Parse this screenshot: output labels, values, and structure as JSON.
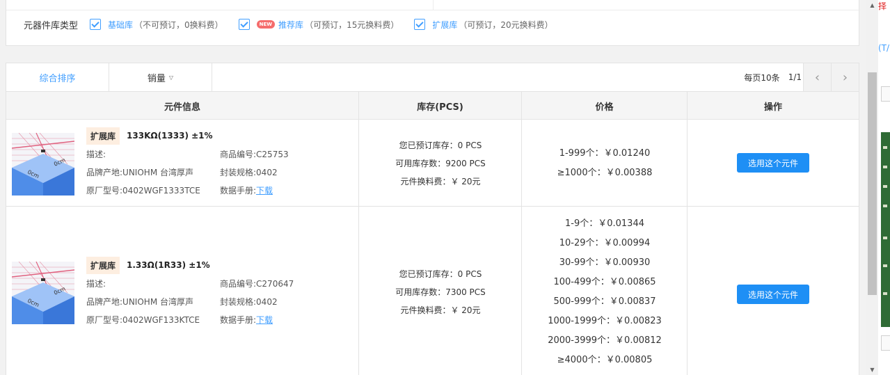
{
  "filter": {
    "label": "元器件库类型",
    "options": [
      {
        "name": "基础库",
        "note": "（不可预订，0换料费）",
        "checked": true,
        "badge": ""
      },
      {
        "name": "推荐库",
        "note": "（可预订，15元换料费）",
        "checked": true,
        "badge": "NEW"
      },
      {
        "name": "扩展库",
        "note": "（可预订，20元换料费）",
        "checked": true,
        "badge": ""
      }
    ]
  },
  "sortbar": {
    "tab_comprehensive": "综合排序",
    "tab_sales": "销量",
    "per_page": "每页10条",
    "page": "1/1"
  },
  "table": {
    "headers": [
      "元件信息",
      "库存(PCS)",
      "价格",
      "操作"
    ],
    "rows": [
      {
        "lib_tag": "扩展库",
        "title": "133KΩ(1333) ±1%",
        "desc_label": "描述:",
        "code_label": "商品编号:",
        "code": "C25753",
        "brand_label": "品牌产地:",
        "brand": "UNIOHM 台湾厚声",
        "package_label": "封装规格:",
        "package": "0402",
        "mpn_label": "原厂型号:",
        "mpn": "0402WGF1333TCE",
        "datasheet_label": "数据手册:",
        "datasheet_link": "下载",
        "stock": [
          "您已预订库存：0 PCS",
          "可用库存数：9200 PCS",
          "元件换料费：￥ 20元"
        ],
        "prices": [
          "1-999个：￥0.01240",
          "≥1000个：￥0.00388"
        ],
        "action": "选用这个元件"
      },
      {
        "lib_tag": "扩展库",
        "title": "1.33Ω(1R33) ±1%",
        "desc_label": "描述:",
        "code_label": "商品编号:",
        "code": "C270647",
        "brand_label": "品牌产地:",
        "brand": "UNIOHM 台湾厚声",
        "package_label": "封装规格:",
        "package": "0402",
        "mpn_label": "原厂型号:",
        "mpn": "0402WGF133KTCE",
        "datasheet_label": "数据手册:",
        "datasheet_link": "下载",
        "stock": [
          "您已预订库存：0 PCS",
          "可用库存数：7300 PCS",
          "元件换料费：￥ 20元"
        ],
        "prices": [
          "1-9个：￥0.01344",
          "10-29个：￥0.00994",
          "30-99个：￥0.00930",
          "100-499个：￥0.00865",
          "500-999个：￥0.00837",
          "1000-1999个：￥0.00823",
          "2000-3999个：￥0.00812",
          "≥4000个：￥0.00805"
        ],
        "action": "选用这个元件"
      }
    ]
  },
  "peek": {
    "top_text": "择",
    "mid_text": "(T/"
  },
  "colors": {
    "accent": "#409eff",
    "button": "#1e8ff5",
    "tag_bg": "#fdeee0",
    "badge": "#f56c6c"
  }
}
